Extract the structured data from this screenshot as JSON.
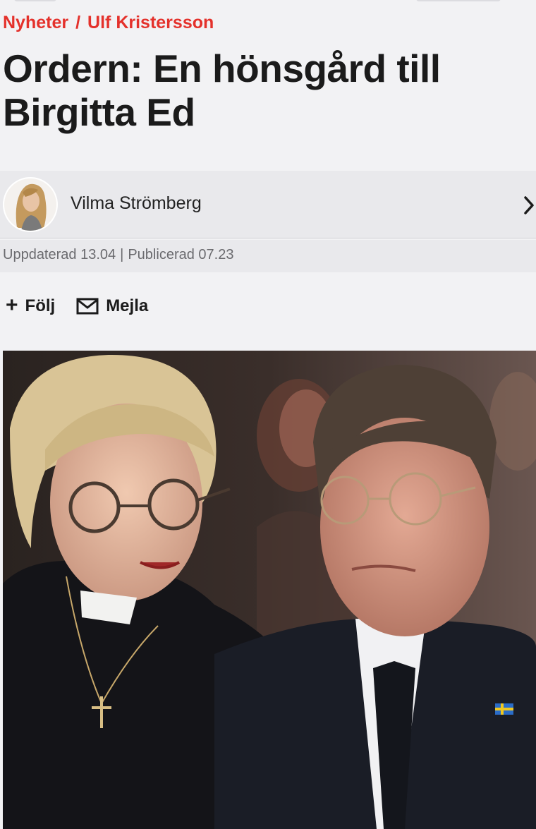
{
  "breadcrumb": {
    "section": "Nyheter",
    "separator": "/",
    "topic": "Ulf Kristersson"
  },
  "article": {
    "title": "Ordern: En hönsgård till Birgitta Ed"
  },
  "author": {
    "name": "Vilma Strömberg",
    "avatar_icon": "author-avatar",
    "chevron_icon": "chevron-right-icon"
  },
  "meta": {
    "updated": "Uppdaterad 13.04",
    "divider": "|",
    "published": "Publicerad 07.23"
  },
  "actions": {
    "follow_label": "Följ",
    "follow_icon": "plus-icon",
    "email_label": "Mejla",
    "email_icon": "envelope-icon"
  },
  "colors": {
    "accent": "#e4312b",
    "background": "#f2f2f4",
    "author_bg": "#e9e9ec",
    "meta_text": "#6a6a6e"
  }
}
